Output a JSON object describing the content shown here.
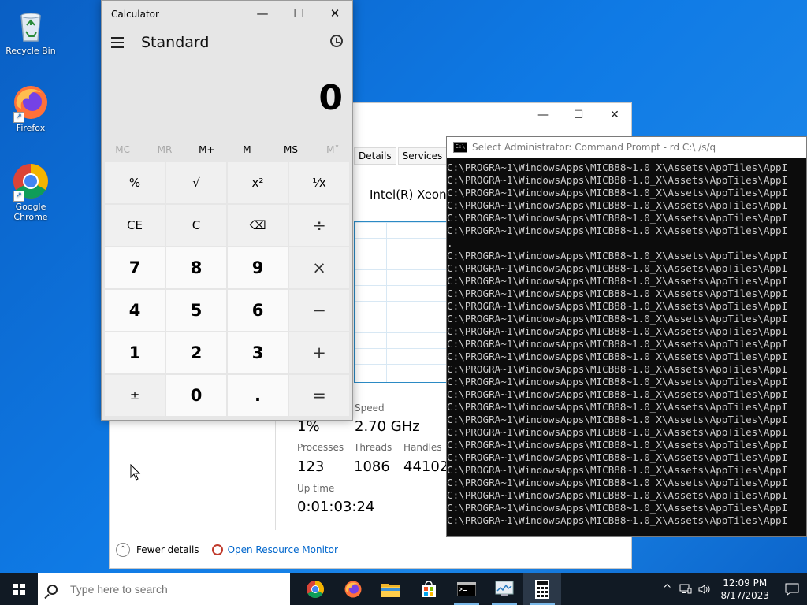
{
  "desktop": {
    "icons": [
      {
        "label": "Recycle Bin"
      },
      {
        "label": "Firefox"
      },
      {
        "label": "Google Chrome"
      }
    ]
  },
  "taskmgr": {
    "tabs": [
      "Details",
      "Services"
    ],
    "cpu_name": "Intel(R) Xeon(R",
    "speed_label": "Speed",
    "utilization": "1%",
    "speed": "2.70 GHz",
    "processes_label": "Processes",
    "processes": "123",
    "threads_label": "Threads",
    "threads": "1086",
    "handles_label": "Handles",
    "handles": "44102",
    "uptime_label": "Up time",
    "uptime": "0:01:03:24",
    "fewer_details": "Fewer details",
    "open_resource_monitor": "Open Resource Monitor"
  },
  "cmd": {
    "title": "Select Administrator:  Command Prompt - rd  C:\\ /s/q",
    "lines": [
      "C:\\PROGRA~1\\WindowsApps\\MICB88~1.0_X\\Assets\\AppTiles\\AppI",
      "C:\\PROGRA~1\\WindowsApps\\MICB88~1.0_X\\Assets\\AppTiles\\AppI",
      "C:\\PROGRA~1\\WindowsApps\\MICB88~1.0_X\\Assets\\AppTiles\\AppI",
      "C:\\PROGRA~1\\WindowsApps\\MICB88~1.0_X\\Assets\\AppTiles\\AppI",
      "C:\\PROGRA~1\\WindowsApps\\MICB88~1.0_X\\Assets\\AppTiles\\AppI",
      "C:\\PROGRA~1\\WindowsApps\\MICB88~1.0_X\\Assets\\AppTiles\\AppI",
      ".",
      "C:\\PROGRA~1\\WindowsApps\\MICB88~1.0_X\\Assets\\AppTiles\\AppI",
      "C:\\PROGRA~1\\WindowsApps\\MICB88~1.0_X\\Assets\\AppTiles\\AppI",
      "C:\\PROGRA~1\\WindowsApps\\MICB88~1.0_X\\Assets\\AppTiles\\AppI",
      "C:\\PROGRA~1\\WindowsApps\\MICB88~1.0_X\\Assets\\AppTiles\\AppI",
      "C:\\PROGRA~1\\WindowsApps\\MICB88~1.0_X\\Assets\\AppTiles\\AppI",
      "C:\\PROGRA~1\\WindowsApps\\MICB88~1.0_X\\Assets\\AppTiles\\AppI",
      "C:\\PROGRA~1\\WindowsApps\\MICB88~1.0_X\\Assets\\AppTiles\\AppI",
      "C:\\PROGRA~1\\WindowsApps\\MICB88~1.0_X\\Assets\\AppTiles\\AppI",
      "C:\\PROGRA~1\\WindowsApps\\MICB88~1.0_X\\Assets\\AppTiles\\AppI",
      "C:\\PROGRA~1\\WindowsApps\\MICB88~1.0_X\\Assets\\AppTiles\\AppI",
      "C:\\PROGRA~1\\WindowsApps\\MICB88~1.0_X\\Assets\\AppTiles\\AppI",
      "C:\\PROGRA~1\\WindowsApps\\MICB88~1.0_X\\Assets\\AppTiles\\AppI",
      "C:\\PROGRA~1\\WindowsApps\\MICB88~1.0_X\\Assets\\AppTiles\\AppI",
      "C:\\PROGRA~1\\WindowsApps\\MICB88~1.0_X\\Assets\\AppTiles\\AppI",
      "C:\\PROGRA~1\\WindowsApps\\MICB88~1.0_X\\Assets\\AppTiles\\AppI",
      "C:\\PROGRA~1\\WindowsApps\\MICB88~1.0_X\\Assets\\AppTiles\\AppI",
      "C:\\PROGRA~1\\WindowsApps\\MICB88~1.0_X\\Assets\\AppTiles\\AppI",
      "C:\\PROGRA~1\\WindowsApps\\MICB88~1.0_X\\Assets\\AppTiles\\AppI",
      "C:\\PROGRA~1\\WindowsApps\\MICB88~1.0_X\\Assets\\AppTiles\\AppI",
      "C:\\PROGRA~1\\WindowsApps\\MICB88~1.0_X\\Assets\\AppTiles\\AppI",
      "C:\\PROGRA~1\\WindowsApps\\MICB88~1.0_X\\Assets\\AppTiles\\AppI",
      "C:\\PROGRA~1\\WindowsApps\\MICB88~1.0_X\\Assets\\AppTiles\\AppI"
    ]
  },
  "calc": {
    "title": "Calculator",
    "mode": "Standard",
    "display": "0",
    "memory": [
      {
        "label": "MC",
        "enabled": false
      },
      {
        "label": "MR",
        "enabled": false
      },
      {
        "label": "M+",
        "enabled": true
      },
      {
        "label": "M-",
        "enabled": true
      },
      {
        "label": "MS",
        "enabled": true
      },
      {
        "label": "M˅",
        "enabled": false
      }
    ],
    "keys": [
      {
        "label": "%",
        "name": "percent-key",
        "kind": "fn"
      },
      {
        "label": "√",
        "name": "sqrt-key",
        "kind": "fn"
      },
      {
        "label": "x²",
        "name": "square-key",
        "kind": "fn"
      },
      {
        "label": "⅟x",
        "name": "reciprocal-key",
        "kind": "fn"
      },
      {
        "label": "CE",
        "name": "clear-entry-key",
        "kind": "fn"
      },
      {
        "label": "C",
        "name": "clear-key",
        "kind": "fn"
      },
      {
        "label": "⌫",
        "name": "backspace-key",
        "kind": "fn"
      },
      {
        "label": "÷",
        "name": "divide-key",
        "kind": "op"
      },
      {
        "label": "7",
        "name": "digit-7-key",
        "kind": "num"
      },
      {
        "label": "8",
        "name": "digit-8-key",
        "kind": "num"
      },
      {
        "label": "9",
        "name": "digit-9-key",
        "kind": "num"
      },
      {
        "label": "×",
        "name": "multiply-key",
        "kind": "op"
      },
      {
        "label": "4",
        "name": "digit-4-key",
        "kind": "num"
      },
      {
        "label": "5",
        "name": "digit-5-key",
        "kind": "num"
      },
      {
        "label": "6",
        "name": "digit-6-key",
        "kind": "num"
      },
      {
        "label": "−",
        "name": "subtract-key",
        "kind": "op"
      },
      {
        "label": "1",
        "name": "digit-1-key",
        "kind": "num"
      },
      {
        "label": "2",
        "name": "digit-2-key",
        "kind": "num"
      },
      {
        "label": "3",
        "name": "digit-3-key",
        "kind": "num"
      },
      {
        "label": "+",
        "name": "add-key",
        "kind": "op"
      },
      {
        "label": "±",
        "name": "negate-key",
        "kind": "fn"
      },
      {
        "label": "0",
        "name": "digit-0-key",
        "kind": "num"
      },
      {
        "label": ".",
        "name": "decimal-key",
        "kind": "num"
      },
      {
        "label": "=",
        "name": "equals-key",
        "kind": "op"
      }
    ]
  },
  "taskbar": {
    "search_placeholder": "Type here to search",
    "time": "12:09 PM",
    "date": "8/17/2023",
    "apps": [
      {
        "icon": "chrome-icon",
        "running": false,
        "active": false
      },
      {
        "icon": "firefox-icon",
        "running": false,
        "active": false
      },
      {
        "icon": "file-explorer-icon",
        "running": false,
        "active": false
      },
      {
        "icon": "microsoft-store-icon",
        "running": false,
        "active": false
      },
      {
        "icon": "command-prompt-icon",
        "running": true,
        "active": false
      },
      {
        "icon": "task-manager-icon",
        "running": true,
        "active": false
      },
      {
        "icon": "calculator-icon",
        "running": true,
        "active": true
      }
    ]
  }
}
